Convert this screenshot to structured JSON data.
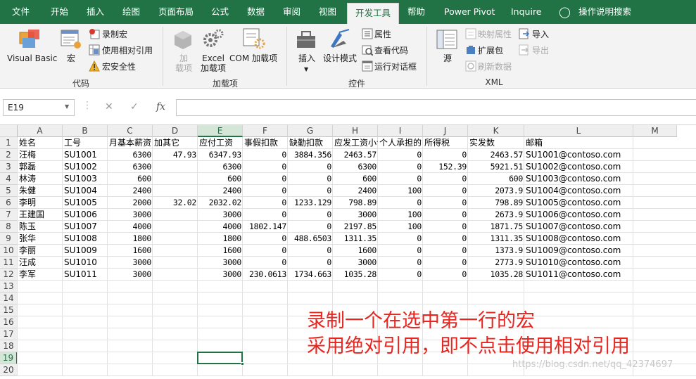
{
  "tabs": [
    {
      "label": "文件",
      "active": false
    },
    {
      "label": "开始",
      "active": false
    },
    {
      "label": "插入",
      "active": false
    },
    {
      "label": "绘图",
      "active": false
    },
    {
      "label": "页面布局",
      "active": false
    },
    {
      "label": "公式",
      "active": false
    },
    {
      "label": "数据",
      "active": false
    },
    {
      "label": "审阅",
      "active": false
    },
    {
      "label": "视图",
      "active": false
    },
    {
      "label": "开发工具",
      "active": true
    },
    {
      "label": "帮助",
      "active": false
    },
    {
      "label": "Power Pivot",
      "active": false
    },
    {
      "label": "Inquire",
      "active": false
    }
  ],
  "tell_me": "操作说明搜索",
  "ribbon": {
    "code": {
      "group_label": "代码",
      "visual_basic": "Visual Basic",
      "macros": "宏",
      "record_macro": "录制宏",
      "relative_ref": "使用相对引用",
      "macro_security": "宏安全性"
    },
    "addins": {
      "group_label": "加载项",
      "addins": "加\n载项",
      "excel_addins": "Excel\n加载项",
      "com_addins": "COM 加载项"
    },
    "controls": {
      "group_label": "控件",
      "insert": "插入",
      "design_mode": "设计模式",
      "properties": "属性",
      "view_code": "查看代码",
      "run_dialog": "运行对话框"
    },
    "xml": {
      "group_label": "XML",
      "source": "源",
      "map_properties": "映射属性",
      "expansion_packs": "扩展包",
      "refresh_data": "刷新数据",
      "import": "导入",
      "export": "导出"
    }
  },
  "formula_bar": {
    "name_box": "E19",
    "cancel": "✕",
    "enter": "✓",
    "fx": "fx",
    "formula": ""
  },
  "columns": [
    "A",
    "B",
    "C",
    "D",
    "E",
    "F",
    "G",
    "H",
    "I",
    "J",
    "K",
    "L",
    "M"
  ],
  "rows": [
    "1",
    "2",
    "3",
    "4",
    "5",
    "6",
    "7",
    "8",
    "9",
    "10",
    "11",
    "12",
    "13",
    "14",
    "15",
    "16",
    "17",
    "18",
    "19",
    "20"
  ],
  "selected_cell": "E19",
  "header_row": [
    "姓名",
    "工号",
    "月基本薪资",
    "加其它",
    "应付工资",
    "事假扣款",
    "缺勤扣款",
    "应发工资小计",
    "个人承担的",
    "所得税",
    "实发数",
    "邮箱"
  ],
  "data_rows": [
    [
      "汪梅",
      "SU1001",
      "6300",
      "47.93",
      "6347.93",
      "0",
      "3884.356",
      "2463.57",
      "0",
      "0",
      "2463.57",
      "SU1001@contoso.com"
    ],
    [
      "郭磊",
      "SU1002",
      "6300",
      "",
      "6300",
      "0",
      "0",
      "6300",
      "0",
      "152.39",
      "5921.51",
      "SU1002@contoso.com"
    ],
    [
      "林涛",
      "SU1003",
      "600",
      "",
      "600",
      "0",
      "0",
      "600",
      "0",
      "0",
      "600",
      "SU1003@contoso.com"
    ],
    [
      "朱健",
      "SU1004",
      "2400",
      "",
      "2400",
      "0",
      "0",
      "2400",
      "100",
      "0",
      "2073.9",
      "SU1004@contoso.com"
    ],
    [
      "李明",
      "SU1005",
      "2000",
      "32.02",
      "2032.02",
      "0",
      "1233.129",
      "798.89",
      "0",
      "0",
      "798.89",
      "SU1005@contoso.com"
    ],
    [
      "王建国",
      "SU1006",
      "3000",
      "",
      "3000",
      "0",
      "0",
      "3000",
      "100",
      "0",
      "2673.9",
      "SU1006@contoso.com"
    ],
    [
      "陈玉",
      "SU1007",
      "4000",
      "",
      "4000",
      "1802.147",
      "0",
      "2197.85",
      "100",
      "0",
      "1871.75",
      "SU1007@contoso.com"
    ],
    [
      "张华",
      "SU1008",
      "1800",
      "",
      "1800",
      "0",
      "488.6503",
      "1311.35",
      "0",
      "0",
      "1311.35",
      "SU1008@contoso.com"
    ],
    [
      "李丽",
      "SU1009",
      "1600",
      "",
      "1600",
      "0",
      "0",
      "1600",
      "0",
      "0",
      "1373.9",
      "SU1009@contoso.com"
    ],
    [
      "汪成",
      "SU1010",
      "3000",
      "",
      "3000",
      "0",
      "0",
      "3000",
      "0",
      "0",
      "2773.9",
      "SU1010@contoso.com"
    ],
    [
      "李军",
      "SU1011",
      "3000",
      "",
      "3000",
      "230.0613",
      "1734.663",
      "1035.28",
      "0",
      "0",
      "1035.28",
      "SU1011@contoso.com"
    ]
  ],
  "annotation": {
    "line1": "录制一个在选中第一行的宏",
    "line2": "采用绝对引用，即不点击使用相对引用"
  },
  "watermark": "https://blog.csdn.net/qq_42374697",
  "colors": {
    "accent": "#217346",
    "annotation": "#e8261f"
  }
}
